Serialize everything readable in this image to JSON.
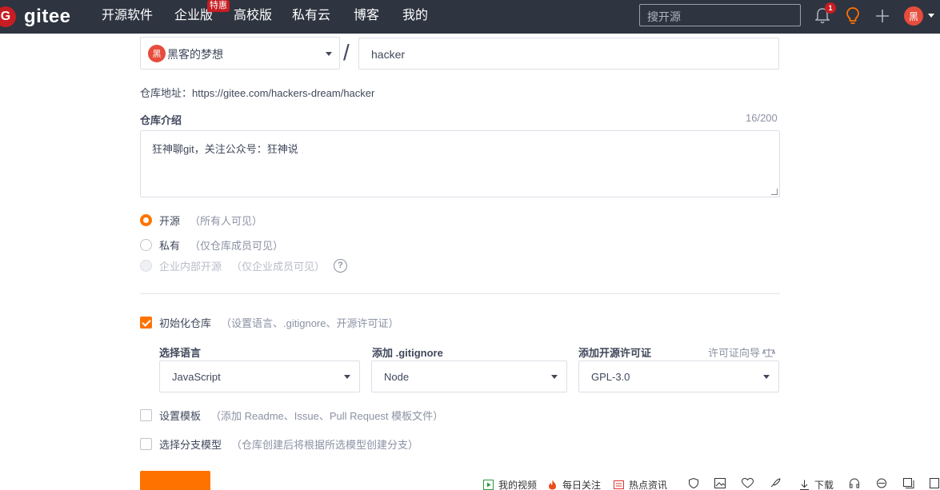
{
  "nav": {
    "logo_badge": "G",
    "logo_text": "gitee",
    "items": [
      "开源软件",
      "企业版",
      "高校版",
      "私有云",
      "博客",
      "我的"
    ],
    "hot_badge": "特惠",
    "search_placeholder": "搜开源",
    "bell_count": "1",
    "avatar_text": "黑"
  },
  "form": {
    "owner": {
      "avatar_text": "黑",
      "name": "黑客的梦想"
    },
    "slash": "/",
    "repo_name": "hacker",
    "address_label": "仓库地址：",
    "address_url": "https://gitee.com/hackers-dream/hacker",
    "description_label": "仓库介绍",
    "description_counter": "16/200",
    "description_value": "狂神聊git，关注公众号：狂神说",
    "visibility": [
      {
        "label": "开源",
        "hint": "（所有人可见）",
        "checked": true,
        "disabled": false
      },
      {
        "label": "私有",
        "hint": "（仅仓库成员可见）",
        "checked": false,
        "disabled": false
      },
      {
        "label": "企业内部开源",
        "hint": "（仅企业成员可见）",
        "checked": false,
        "disabled": true
      }
    ],
    "help_icon": "?",
    "init": {
      "label": "初始化仓库",
      "hint": "（设置语言、.gitignore、开源许可证）",
      "checked": true
    },
    "language": {
      "label": "选择语言",
      "value": "JavaScript"
    },
    "gitignore": {
      "label": "添加 .gitignore",
      "value": "Node"
    },
    "license": {
      "label": "添加开源许可证",
      "value": "GPL-3.0",
      "guide": "许可证向导"
    },
    "template": {
      "label": "设置模板",
      "hint": "（添加 Readme、Issue、Pull Request 模板文件）",
      "checked": false
    },
    "branch": {
      "label": "选择分支模型",
      "hint": "（仓库创建后将根据所选模型创建分支）",
      "checked": false
    }
  },
  "statusbar": {
    "items": [
      "我的视频",
      "每日关注",
      "热点资讯",
      "下载"
    ]
  },
  "colors": {
    "accent": "#fe7300",
    "nav_bg": "#2e3440",
    "brand": "#c71d23"
  }
}
